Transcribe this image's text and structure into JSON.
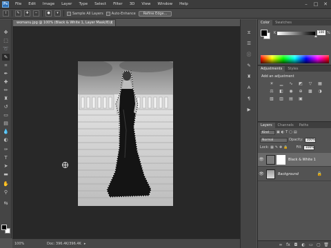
{
  "menubar": {
    "logo": "Ps",
    "items": [
      "File",
      "Edit",
      "Image",
      "Layer",
      "Type",
      "Select",
      "Filter",
      "3D",
      "View",
      "Window",
      "Help"
    ],
    "window_controls": [
      "–",
      "□",
      "✕"
    ]
  },
  "options": {
    "sample_all_layers": "Sample All Layers",
    "auto_enhance": "Auto-Enhance",
    "refine_edge": "Refine Edge..."
  },
  "document": {
    "tab_title": "womanu.jpg @ 100% (Black & White 1, Layer Mask/8) *",
    "tab_close": "×"
  },
  "status": {
    "zoom": "100%",
    "doc_size": "Doc: 396.4K/396.4K",
    "arrow": "▸"
  },
  "panels": {
    "color_tabs": [
      "Color",
      "Swatches"
    ],
    "color_channel": "K",
    "color_value": "100",
    "color_unit": "%",
    "adjust_tabs": [
      "Adjustments",
      "Styles"
    ],
    "adjust_title": "Add an adjustment",
    "layers_tabs": [
      "Layers",
      "Channels",
      "Paths"
    ],
    "kind": "Kind",
    "blend_mode": "Normal",
    "opacity_label": "Opacity:",
    "opacity_value": "100%",
    "lock_label": "Lock:",
    "fill_label": "Fill:",
    "fill_value": "100%",
    "layers": [
      {
        "name": "Black & White 1"
      },
      {
        "name": "Background"
      }
    ]
  },
  "icons": {
    "tools": [
      "move-icon",
      "marquee-icon",
      "lasso-icon",
      "quick-selection-icon",
      "crop-icon",
      "eyedropper-icon",
      "spot-heal-icon",
      "brush-icon",
      "clone-stamp-icon",
      "history-brush-icon",
      "eraser-icon",
      "gradient-icon",
      "blur-icon",
      "dodge-icon",
      "pen-icon",
      "type-icon",
      "path-select-icon",
      "rectangle-icon",
      "hand-icon",
      "zoom-icon"
    ]
  }
}
